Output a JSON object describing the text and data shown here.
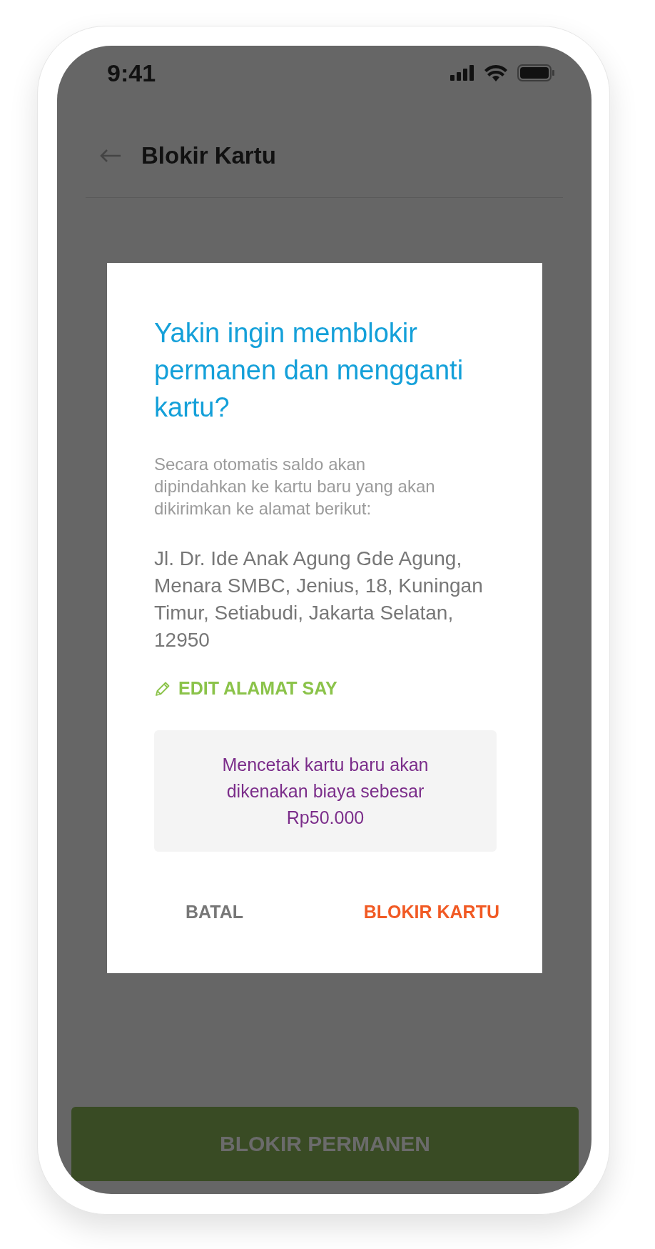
{
  "status_bar": {
    "time": "9:41"
  },
  "header": {
    "title": "Blokir Kartu"
  },
  "dialog": {
    "title": "Yakin ingin memblokir permanen dan mengganti kartu?",
    "message": "Secara otomatis saldo akan dipindahkan ke kartu baru yang akan dikirimkan ke alamat berikut:",
    "address": "Jl. Dr. Ide Anak Agung Gde Agung, Menara SMBC, Jenius, 18, Kuningan Timur, Setiabudi, Jakarta Selatan, 12950",
    "edit_link": "EDIT ALAMAT SAY",
    "notice": "Mencetak kartu baru akan dikenakan biaya sebesar Rp50.000",
    "buttons": [
      {
        "label": "BATAL",
        "kind": "secondary"
      },
      {
        "label": "BLOKIR KARTU",
        "kind": "primary"
      }
    ]
  },
  "primary_button": {
    "label": "BLOKIR PERMANEN"
  }
}
